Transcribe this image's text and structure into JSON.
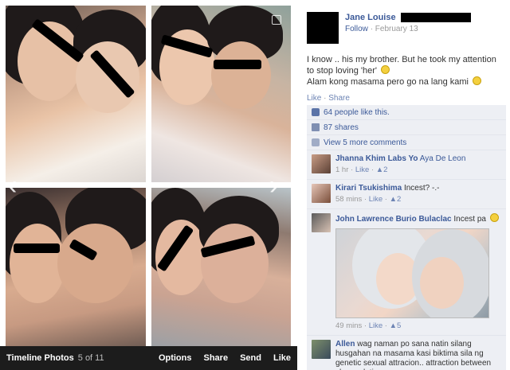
{
  "viewer": {
    "title": "Timeline Photos",
    "count": "5 of 11",
    "actions": [
      "Options",
      "Share",
      "Send",
      "Like"
    ]
  },
  "post": {
    "author": "Jane Louise",
    "follow": "Follow",
    "date": "February 13",
    "caption_line1": "I know .. his my brother. But he took my attention to stop loving 'her'",
    "caption_line2": "Alam kong masama pero go na lang kami",
    "like_action": "Like",
    "share_action": "Share",
    "likes": "64 people like this.",
    "shares": "87 shares",
    "view_more": "View 5 more comments"
  },
  "comments": [
    {
      "name": "Jhanna Khim Labs Yo",
      "text": "Aya De Leon",
      "time": "1 hr",
      "like": "Like",
      "likes": "2"
    },
    {
      "name": "Kirari Tsukishima",
      "text": "Incest? -.-",
      "time": "58 mins",
      "like": "Like",
      "likes": "2"
    },
    {
      "name": "John Lawrence Burio Bulaclac",
      "text": "Incest pa",
      "time": "49 mins",
      "like": "Like",
      "likes": "5"
    },
    {
      "name": "Allen",
      "text": "wag naman po sana natin silang husgahan na masama kasi biktima sila ng genetic sexual attracion.. attraction between close relatives"
    }
  ],
  "colors": {
    "link": "#3b5998",
    "ufi_bg": "#edeff4",
    "bar": "#1c1c1c"
  }
}
